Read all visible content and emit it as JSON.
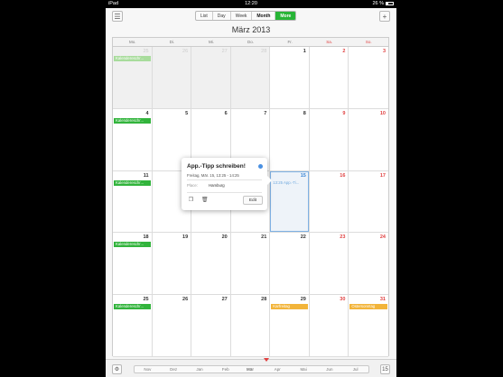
{
  "status_bar": {
    "carrier": "iPad",
    "time": "12:20",
    "status_right": "26 %"
  },
  "toolbar": {
    "views": [
      {
        "label": "List",
        "active": false
      },
      {
        "label": "Day",
        "active": false
      },
      {
        "label": "Week",
        "active": false
      },
      {
        "label": "Month",
        "active": true
      },
      {
        "label": "More",
        "active": false
      }
    ],
    "left_icon": "calendars-list-icon",
    "add_label": "+"
  },
  "month_title": "März 2013",
  "weekdays": [
    "Mo.",
    "Di.",
    "Mi.",
    "Do.",
    "Fr.",
    "Sa.",
    "So."
  ],
  "weeks": [
    [
      {
        "day": "25",
        "in_month": false,
        "event": {
          "title": "Kalendereschr...",
          "color": "green",
          "faded": true
        }
      },
      {
        "day": "26",
        "in_month": false
      },
      {
        "day": "27",
        "in_month": false
      },
      {
        "day": "28",
        "in_month": false
      },
      {
        "day": "1",
        "in_month": true
      },
      {
        "day": "2",
        "in_month": true,
        "weekend": true
      },
      {
        "day": "3",
        "in_month": true,
        "weekend": true
      }
    ],
    [
      {
        "day": "4",
        "in_month": true,
        "event": {
          "title": "Kalendereschr...",
          "color": "green"
        }
      },
      {
        "day": "5",
        "in_month": true
      },
      {
        "day": "6",
        "in_month": true
      },
      {
        "day": "7",
        "in_month": true
      },
      {
        "day": "8",
        "in_month": true
      },
      {
        "day": "9",
        "in_month": true,
        "weekend": true
      },
      {
        "day": "10",
        "in_month": true,
        "weekend": true
      }
    ],
    [
      {
        "day": "11",
        "in_month": true,
        "event": {
          "title": "Kalendereschr...",
          "color": "green"
        }
      },
      {
        "day": "12",
        "in_month": true
      },
      {
        "day": "13",
        "in_month": true
      },
      {
        "day": "14",
        "in_month": true
      },
      {
        "day": "15",
        "in_month": true,
        "today": true,
        "event": {
          "title": "13:25 App.-Ti...",
          "color": "plain"
        }
      },
      {
        "day": "16",
        "in_month": true,
        "weekend": true
      },
      {
        "day": "17",
        "in_month": true,
        "weekend": true
      }
    ],
    [
      {
        "day": "18",
        "in_month": true,
        "event": {
          "title": "Kalendereschr...",
          "color": "green"
        }
      },
      {
        "day": "19",
        "in_month": true
      },
      {
        "day": "20",
        "in_month": true
      },
      {
        "day": "21",
        "in_month": true
      },
      {
        "day": "22",
        "in_month": true
      },
      {
        "day": "23",
        "in_month": true,
        "weekend": true
      },
      {
        "day": "24",
        "in_month": true,
        "weekend": true
      }
    ],
    [
      {
        "day": "25",
        "in_month": true,
        "event": {
          "title": "Kalendereschr...",
          "color": "green"
        }
      },
      {
        "day": "26",
        "in_month": true
      },
      {
        "day": "27",
        "in_month": true
      },
      {
        "day": "28",
        "in_month": true
      },
      {
        "day": "29",
        "in_month": true,
        "event": {
          "title": "Karfreitag",
          "color": "orange"
        }
      },
      {
        "day": "30",
        "in_month": true,
        "weekend": true
      },
      {
        "day": "31",
        "in_month": true,
        "weekend": true,
        "event": {
          "title": "Ostersonntag",
          "color": "orange"
        }
      }
    ]
  ],
  "popover": {
    "title": "App.-Tipp schreiben!",
    "time": "Freitag, Mär. 15, 13:25 - 14:25",
    "place_label": "Place:",
    "place": "Hamburg",
    "edit_label": "Edit",
    "dot_color": "#4a90e2"
  },
  "bottom_bar": {
    "months": [
      "Nov",
      "Dez",
      "Jan",
      "Feb",
      "Mär",
      "Apr",
      "Mai",
      "Jun",
      "Jul"
    ],
    "current_month": "Mär",
    "today_label": "15",
    "settings_icon": "gear-icon"
  },
  "colors": {
    "accent_green": "#27b436",
    "weekend_red": "#e04040",
    "today_blue": "#3a86d6",
    "holiday_orange": "#f2b43a"
  }
}
